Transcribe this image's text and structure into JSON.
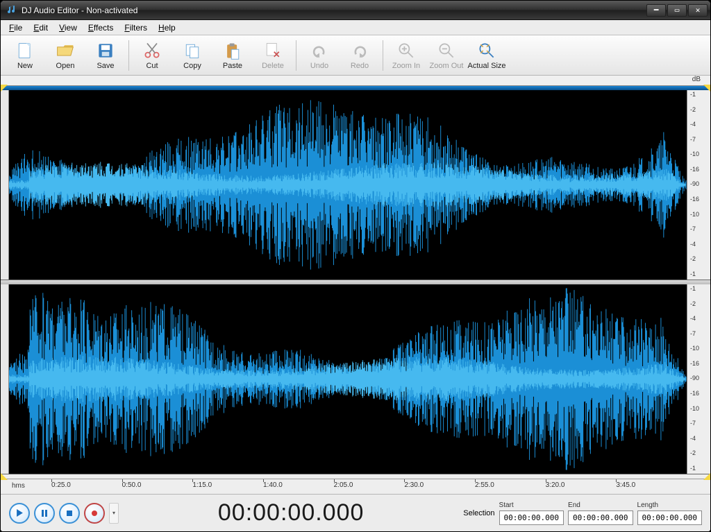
{
  "window": {
    "title": "DJ Audio Editor - Non-activated"
  },
  "menu": [
    "File",
    "Edit",
    "View",
    "Effects",
    "Filters",
    "Help"
  ],
  "toolbar": [
    {
      "name": "new",
      "label": "New",
      "enabled": true
    },
    {
      "name": "open",
      "label": "Open",
      "enabled": true
    },
    {
      "name": "save",
      "label": "Save",
      "enabled": true
    },
    {
      "sep": true
    },
    {
      "name": "cut",
      "label": "Cut",
      "enabled": true
    },
    {
      "name": "copy",
      "label": "Copy",
      "enabled": true
    },
    {
      "name": "paste",
      "label": "Paste",
      "enabled": true
    },
    {
      "name": "delete",
      "label": "Delete",
      "enabled": false
    },
    {
      "sep": true
    },
    {
      "name": "undo",
      "label": "Undo",
      "enabled": false
    },
    {
      "name": "redo",
      "label": "Redo",
      "enabled": false
    },
    {
      "sep": true
    },
    {
      "name": "zoomin",
      "label": "Zoom In",
      "enabled": false
    },
    {
      "name": "zoomout",
      "label": "Zoom Out",
      "enabled": false
    },
    {
      "name": "actualsize",
      "label": "Actual Size",
      "enabled": true
    }
  ],
  "db_header": "dB",
  "db_scale": [
    "-1",
    "-2",
    "-4",
    "-7",
    "-10",
    "-16",
    "-90",
    "-16",
    "-10",
    "-7",
    "-4",
    "-2",
    "-1"
  ],
  "time_unit": "hms",
  "time_ticks": [
    "0:25.0",
    "0:50.0",
    "1:15.0",
    "1:40.0",
    "2:05.0",
    "2:30.0",
    "2:55.0",
    "3:20.0",
    "3:45.0"
  ],
  "playback": {
    "timecode": "00:00:00.000"
  },
  "selection": {
    "label": "Selection",
    "start_label": "Start",
    "end_label": "End",
    "length_label": "Length",
    "start": "00:00:00.000",
    "end": "00:00:00.000",
    "length": "00:00:00.000"
  }
}
